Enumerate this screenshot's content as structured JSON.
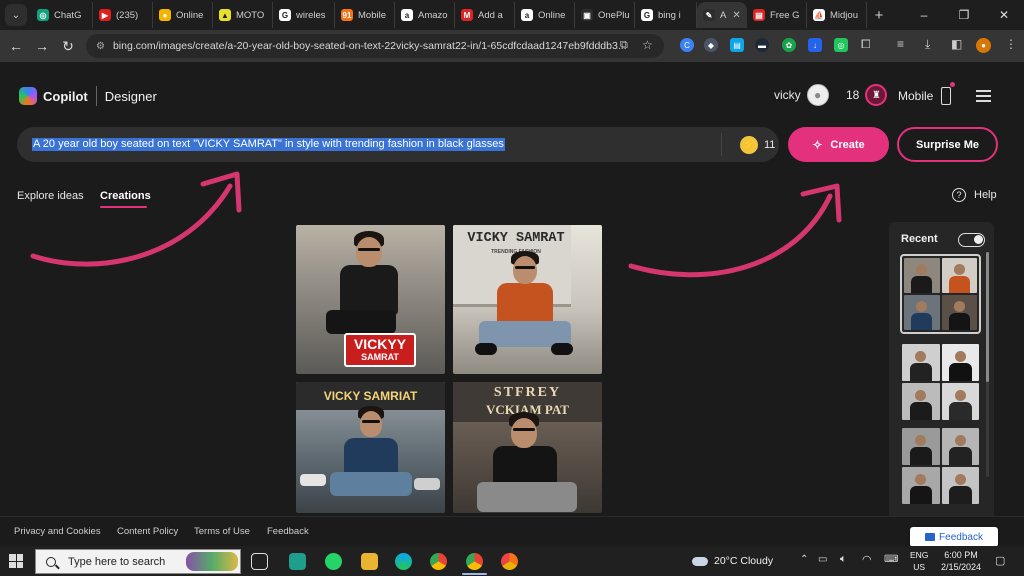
{
  "browser": {
    "tabs": [
      {
        "label": "ChatG",
        "fav_color": "#10a37f",
        "fav_glyph": "◎"
      },
      {
        "label": "(235) ",
        "fav_color": "#e11d1d",
        "fav_glyph": "▶"
      },
      {
        "label": "Online",
        "fav_color": "#f4b400",
        "fav_glyph": "●"
      },
      {
        "label": "MOTO",
        "fav_color": "#e6e02a",
        "fav_glyph": "▲"
      },
      {
        "label": "wireles",
        "fav_color": "#ffffff",
        "fav_glyph": "G"
      },
      {
        "label": "Mobile",
        "fav_color": "#f97316",
        "fav_glyph": "91"
      },
      {
        "label": "Amazo",
        "fav_color": "#ffffff",
        "fav_glyph": "a"
      },
      {
        "label": "Add a",
        "fav_color": "#dc2626",
        "fav_glyph": "M"
      },
      {
        "label": "Online",
        "fav_color": "#ffffff",
        "fav_glyph": "a"
      },
      {
        "label": "OnePlu",
        "fav_color": "#2d2d2d",
        "fav_glyph": "▣"
      },
      {
        "label": "bing i",
        "fav_color": "#ffffff",
        "fav_glyph": "G"
      },
      {
        "label": "A",
        "fav_color": "#2d2d2d",
        "fav_glyph": "✎",
        "active": true
      },
      {
        "label": "Free G",
        "fav_color": "#dc2626",
        "fav_glyph": "▤"
      },
      {
        "label": "Midjou",
        "fav_color": "#ffffff",
        "fav_glyph": "⛵"
      }
    ],
    "new_tab_glyph": "+",
    "tab_close_glyph": "✕",
    "window_controls": [
      "–",
      "❐",
      "✕"
    ],
    "url": "bing.com/images/create/a-20-year-old-boy-seated-on-text-22vicky-samrat22-in/1-65cdfcdaad1247eb9fdddb3..."
  },
  "header": {
    "brand": "Copilot",
    "product": "Designer",
    "username": "vicky",
    "reward_count": "18",
    "mobile_label": "Mobile"
  },
  "prompt": {
    "text": "A 20 year old boy seated on text \"VICKY SAMRAT\" in style with trending fashion in black glasses",
    "boosts": "11",
    "create_label": "Create",
    "surprise_label": "Surprise Me"
  },
  "subnav": {
    "explore": "Explore ideas",
    "creations": "Creations",
    "help": "Help"
  },
  "images": [
    {
      "sign": "VICKYY",
      "sign2": "SAMRAT"
    },
    {
      "sign": "VICKY SAMRAT",
      "sign2": "TRENDING FASHION"
    },
    {
      "sign": "VICKY SAMRIAT",
      "sign2": ""
    },
    {
      "sign": "STFREY",
      "sign2": "VCKIAM PAT"
    }
  ],
  "recent": {
    "label": "Recent"
  },
  "footer": {
    "privacy": "Privacy and Cookies",
    "content_policy": "Content Policy",
    "terms": "Terms of Use",
    "feedback": "Feedback",
    "feedback_button": "Feedback"
  },
  "taskbar": {
    "search_placeholder": "Type here to search",
    "weather": "20°C  Cloudy",
    "lang": "ENG",
    "region": "US",
    "time": "6:00 PM",
    "date": "2/15/2024"
  },
  "colors": {
    "accent": "#e3317e",
    "selection": "#3a73d6",
    "background": "#1b1b1b"
  }
}
